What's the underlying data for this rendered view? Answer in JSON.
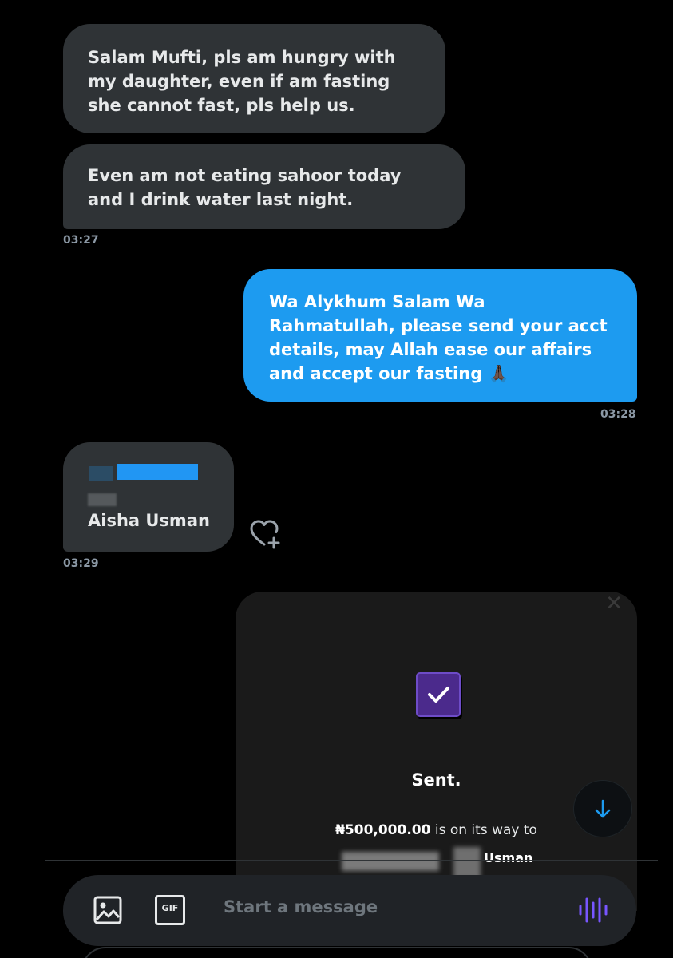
{
  "messages": [
    {
      "text": "Salam Mufti, pls am hungry with my daughter, even if am fasting she cannot fast, pls help us."
    },
    {
      "text": "Even am not eating sahoor today and I drink water last night."
    },
    {
      "time": "03:27"
    },
    {
      "text": "Wa Alykhum Salam Wa Rahmatullah, please send your acct details, may Allah ease our affairs and accept our fasting 🙏🏿",
      "time": "03:28"
    },
    {
      "account_name": "Aisha Usman",
      "time": "03:29"
    }
  ],
  "transfer_card": {
    "title": "Sent.",
    "amount": "₦500,000.00",
    "line_suffix": " is on its way to",
    "recipient_visible": "Usman",
    "icon": "checkmark-icon",
    "accent": "#4b2a8c"
  },
  "composer": {
    "placeholder": "Start a message",
    "gif_label": "GIF",
    "icons": [
      "image-icon",
      "gif-icon",
      "voice-icon"
    ]
  },
  "colors": {
    "incoming_bubble": "#2f3336",
    "outgoing_bubble": "#1d9bf0",
    "background": "#000000",
    "voice_icon": "#7856ff"
  }
}
